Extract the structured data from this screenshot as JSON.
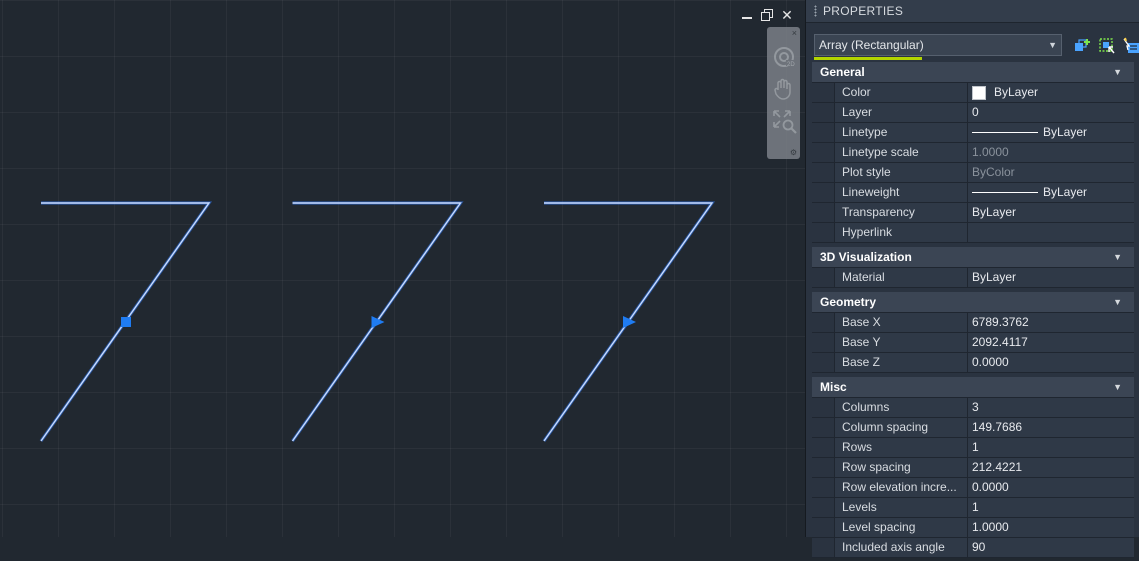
{
  "canvas": {
    "window_controls": [
      "minimize",
      "restore",
      "close"
    ],
    "close_glyph": "✕",
    "navbar": {
      "items": [
        "steering-wheel-icon",
        "pan-hand-icon",
        "zoom-extents-icon"
      ],
      "close_glyph": "×",
      "settings_glyph": "⚙"
    }
  },
  "palette": {
    "title": "PROPERTIES",
    "selector": {
      "value": "Array (Rectangular)",
      "toggle_glyph": "▼"
    },
    "tools": [
      "toggle-pickadd-icon",
      "select-objects-icon",
      "quick-select-icon"
    ],
    "sections": [
      {
        "title": "General",
        "rows": [
          {
            "name": "Color",
            "value": "ByLayer",
            "kind": "color",
            "swatch": "#ffffff"
          },
          {
            "name": "Layer",
            "value": "0"
          },
          {
            "name": "Linetype",
            "value": "ByLayer",
            "kind": "line"
          },
          {
            "name": "Linetype scale",
            "value": "1.0000",
            "muted": true
          },
          {
            "name": "Plot style",
            "value": "ByColor",
            "muted": true
          },
          {
            "name": "Lineweight",
            "value": "ByLayer",
            "kind": "line"
          },
          {
            "name": "Transparency",
            "value": "ByLayer"
          },
          {
            "name": "Hyperlink",
            "value": ""
          }
        ]
      },
      {
        "title": "3D Visualization",
        "rows": [
          {
            "name": "Material",
            "value": "ByLayer"
          }
        ]
      },
      {
        "title": "Geometry",
        "rows": [
          {
            "name": "Base X",
            "value": "6789.3762"
          },
          {
            "name": "Base Y",
            "value": "2092.4117"
          },
          {
            "name": "Base Z",
            "value": "0.0000"
          }
        ]
      },
      {
        "title": "Misc",
        "rows": [
          {
            "name": "Columns",
            "value": "3"
          },
          {
            "name": "Column spacing",
            "value": "149.7686"
          },
          {
            "name": "Rows",
            "value": "1"
          },
          {
            "name": "Row spacing",
            "value": "212.4221"
          },
          {
            "name": "Row elevation incre...",
            "value": "0.0000"
          },
          {
            "name": "Levels",
            "value": "1"
          },
          {
            "name": "Level spacing",
            "value": "1.0000"
          },
          {
            "name": "Included axis angle",
            "value": "90"
          }
        ]
      }
    ]
  },
  "colors": {
    "line": "#c9dcff",
    "line_glow": "#2f7bff",
    "grip": "#1f7cf2",
    "accent_underline": "#b2d400"
  }
}
